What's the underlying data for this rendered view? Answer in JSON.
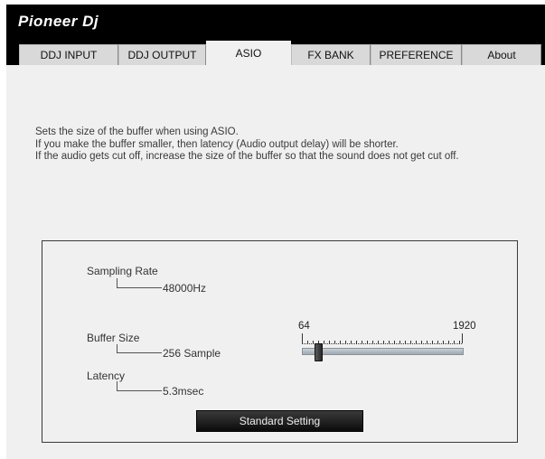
{
  "brand": {
    "logo_text": "Pioneer Dj"
  },
  "tabs": [
    {
      "label": "DDJ INPUT",
      "active": false
    },
    {
      "label": "DDJ OUTPUT",
      "active": false
    },
    {
      "label": "ASIO",
      "active": true
    },
    {
      "label": "FX BANK",
      "active": false
    },
    {
      "label": "PREFERENCE",
      "active": false
    },
    {
      "label": "About",
      "active": false
    }
  ],
  "description": [
    "Sets the size of the buffer when using ASIO.",
    "If you make the buffer smaller, then latency (Audio output delay) will be shorter.",
    "If the audio gets cut off, increase the size of the buffer so that the sound does not get cut off."
  ],
  "settings": {
    "sampling_rate": {
      "label": "Sampling Rate",
      "value": "48000Hz"
    },
    "buffer_size": {
      "label": "Buffer Size",
      "value": "256 Sample"
    },
    "latency": {
      "label": "Latency",
      "value": "5.3msec"
    },
    "slider": {
      "min_label": "64",
      "max_label": "1920",
      "fraction": 0.1
    },
    "standard_button": "Standard Setting"
  },
  "colors": {
    "header": "#000000",
    "background": "#f0f0f0",
    "tab_inactive": "#d9d9d9",
    "button": "#1a1a1a"
  }
}
